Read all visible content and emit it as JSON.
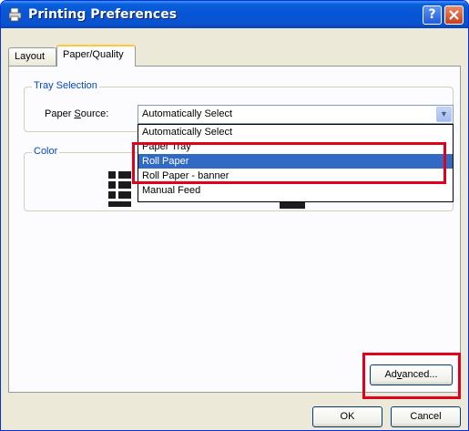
{
  "window": {
    "title": "Printing Preferences",
    "help_label": "?",
    "close_label": "X"
  },
  "tabs": [
    {
      "label": "Layout",
      "active": false
    },
    {
      "label": "Paper/Quality",
      "active": true
    }
  ],
  "tray_selection": {
    "legend": "Tray Selection",
    "paper_source_label_pre": "Paper ",
    "paper_source_label_key": "S",
    "paper_source_label_post": "ource:",
    "selected_value": "Automatically Select",
    "options": [
      "Automatically Select",
      "Paper Tray",
      "Roll Paper",
      "Roll Paper - banner",
      "Manual Feed"
    ],
    "highlighted_option": "Roll Paper"
  },
  "color": {
    "legend": "Color"
  },
  "buttons": {
    "advanced_pre": "Ad",
    "advanced_key": "v",
    "advanced_post": "anced...",
    "ok": "OK",
    "cancel": "Cancel"
  },
  "colors": {
    "title_bar": "#0654d6",
    "highlight": "#e0001b",
    "selection": "#316ac5"
  }
}
